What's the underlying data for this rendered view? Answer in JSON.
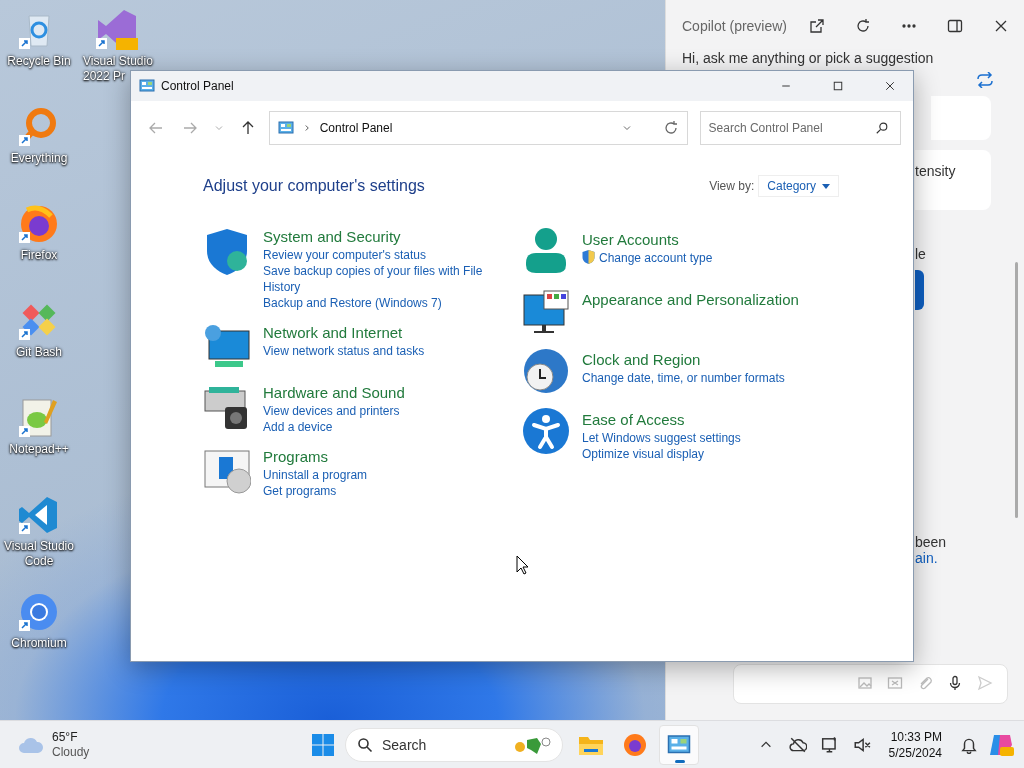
{
  "desktop": {
    "icon_columns": [
      [
        {
          "label": "Recycle Bin",
          "kind": "recycle"
        },
        {
          "label": "Everything",
          "kind": "everything"
        },
        {
          "label": "Firefox",
          "kind": "firefox"
        },
        {
          "label": "Git Bash",
          "kind": "gitbash"
        },
        {
          "label": "Notepad++",
          "kind": "notepad"
        },
        {
          "label": "Visual Studio Code",
          "kind": "vscode"
        },
        {
          "label": "Chromium",
          "kind": "chromium"
        }
      ],
      [
        {
          "label": "Visual Studio 2022 Pr",
          "kind": "vs"
        }
      ]
    ]
  },
  "copilot": {
    "title": "Copilot (preview)",
    "greeting": "Hi, ask me anything or pick a suggestion",
    "fragments": [
      "tensity",
      "le",
      "been"
    ],
    "link_fragment": "ain."
  },
  "window": {
    "title": "Control Panel",
    "address": "Control Panel",
    "search": {
      "placeholder": "Search Control Panel"
    },
    "heading": "Adjust your computer's settings",
    "view_by_label": "View by:",
    "view_by_value": "Category",
    "columns": [
      [
        {
          "kind": "security",
          "title": "System and Security",
          "links": [
            {
              "text": "Review your computer's status",
              "shield": false
            },
            {
              "text": "Save backup copies of your files with File History",
              "shield": false
            },
            {
              "text": "Backup and Restore (Windows 7)",
              "shield": false
            }
          ]
        },
        {
          "kind": "network",
          "title": "Network and Internet",
          "links": [
            {
              "text": "View network status and tasks",
              "shield": false
            }
          ]
        },
        {
          "kind": "hardware",
          "title": "Hardware and Sound",
          "links": [
            {
              "text": "View devices and printers",
              "shield": false
            },
            {
              "text": "Add a device",
              "shield": false
            }
          ]
        },
        {
          "kind": "programs",
          "title": "Programs",
          "links": [
            {
              "text": "Uninstall a program",
              "shield": false
            },
            {
              "text": "Get programs",
              "shield": false
            }
          ]
        }
      ],
      [
        {
          "kind": "user",
          "title": "User Accounts",
          "links": [
            {
              "text": "Change account type",
              "shield": true
            }
          ]
        },
        {
          "kind": "appearance",
          "title": "Appearance and Personalization"
        },
        {
          "kind": "clock",
          "title": "Clock and Region",
          "links": [
            {
              "text": "Change date, time, or number formats",
              "shield": false
            }
          ]
        },
        {
          "kind": "access",
          "title": "Ease of Access",
          "links": [
            {
              "text": "Let Windows suggest settings",
              "shield": false
            },
            {
              "text": "Optimize visual display",
              "shield": false
            }
          ]
        }
      ]
    ]
  },
  "taskbar": {
    "weather": {
      "temp": "65°F",
      "condition": "Cloudy"
    },
    "search": {
      "placeholder": "Search"
    },
    "apps": [
      {
        "kind": "explorer",
        "selected": false
      },
      {
        "kind": "firefox",
        "selected": false
      },
      {
        "kind": "controlpanel",
        "selected": true
      }
    ],
    "time": "10:33 PM",
    "date": "5/25/2024"
  }
}
